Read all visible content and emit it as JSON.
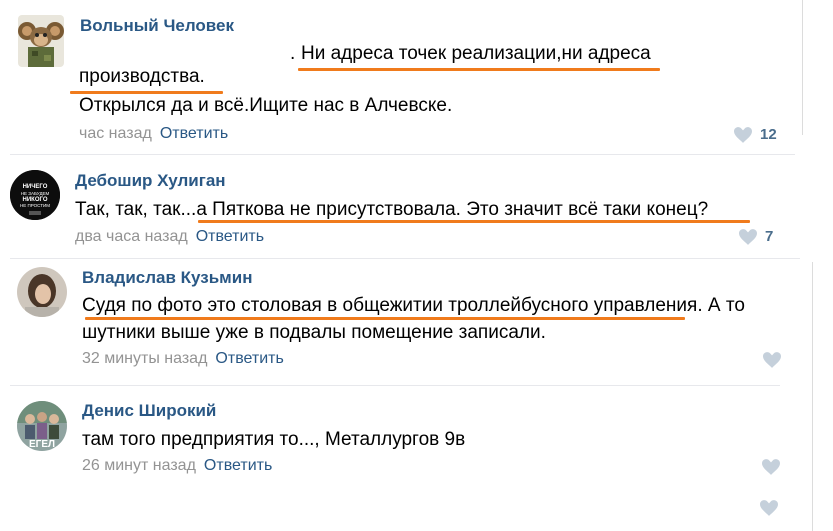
{
  "comments": [
    {
      "author": "Вольный Человек",
      "prefix": ".",
      "lines": [
        "Ни адреса точек реализации,ни адреса",
        "производства.",
        "Открылся да и всё.Ищите нас в Алчевске."
      ],
      "time": "час назад",
      "reply_label": "Ответить",
      "likes": "12",
      "avatar_icon": "cheburashka-avatar-icon"
    },
    {
      "author": "Дебошир Хулиган",
      "lines": [
        "Так, так, так...а Пяткова не присутствовала. Это значит всё таки конец?"
      ],
      "time": "два часа назад",
      "reply_label": "Ответить",
      "likes": "7",
      "avatar_text": "НИЧЕГО НЕ ЗАБУДЕМ НИКОГО НЕ ПРОСТИМ"
    },
    {
      "author": "Владислав Кузьмин",
      "lines": [
        "Судя по фото это столовая в общежитии троллейбусного управления. А то",
        "шутники выше уже в подвалы помещение записали."
      ],
      "time": "32 минуты назад",
      "reply_label": "Ответить",
      "likes": "",
      "avatar_icon": "person-photo-avatar-icon"
    },
    {
      "author": "Денис Широкий",
      "lines": [
        "там того предприятия то..., Металлургов 9в"
      ],
      "time": "26 минут назад",
      "reply_label": "Ответить",
      "likes": "",
      "avatar_text": "ЕГЕЛ"
    }
  ],
  "colors": {
    "link": "#2a5885",
    "muted": "#939393",
    "like_icon": "#c5d0db",
    "highlight_underline": "#f07b1c"
  }
}
